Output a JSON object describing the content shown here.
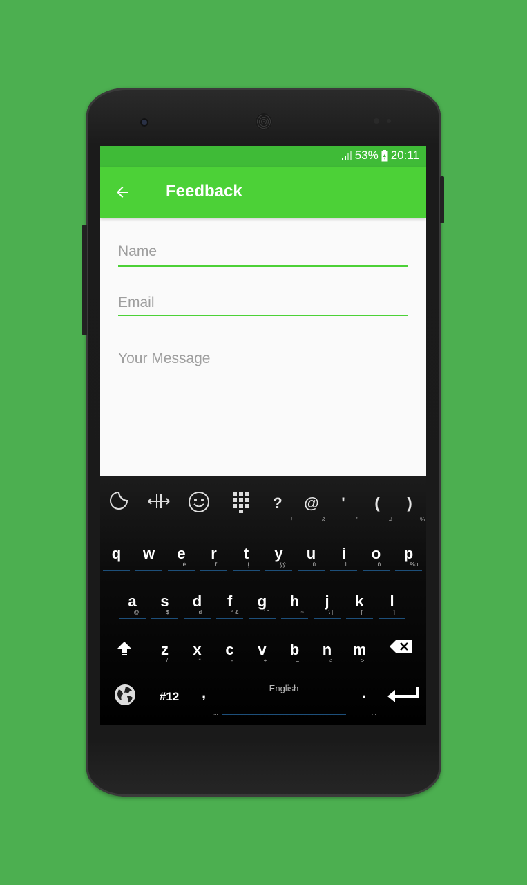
{
  "status_bar": {
    "battery": "53%",
    "time": "20:11"
  },
  "app_bar": {
    "title": "Feedback"
  },
  "form": {
    "name_placeholder": "Name",
    "email_placeholder": "Email",
    "message_placeholder": "Your Message"
  },
  "keyboard": {
    "symbols_row": [
      {
        "label": "?",
        "hint": "!"
      },
      {
        "label": "@",
        "hint": "&"
      },
      {
        "label": "'",
        "hint": "\""
      },
      {
        "label": "(",
        "hint": "#"
      },
      {
        "label": ")",
        "hint": "%"
      }
    ],
    "row1": [
      {
        "label": "q",
        "hint": ""
      },
      {
        "label": "w",
        "hint": ""
      },
      {
        "label": "e",
        "hint": "è"
      },
      {
        "label": "r",
        "hint": "ř"
      },
      {
        "label": "t",
        "hint": "ţ"
      },
      {
        "label": "y",
        "hint": "ÿý"
      },
      {
        "label": "u",
        "hint": "ü"
      },
      {
        "label": "i",
        "hint": "ì"
      },
      {
        "label": "o",
        "hint": "ö"
      },
      {
        "label": "p",
        "hint": "%π"
      }
    ],
    "row2": [
      {
        "label": "a",
        "hint": "@"
      },
      {
        "label": "s",
        "hint": "$"
      },
      {
        "label": "d",
        "hint": "d"
      },
      {
        "label": "f",
        "hint": "* &"
      },
      {
        "label": "g",
        "hint": "` \""
      },
      {
        "label": "h",
        "hint": "_ ~"
      },
      {
        "label": "j",
        "hint": "\\ |"
      },
      {
        "label": "k",
        "hint": "["
      },
      {
        "label": "l",
        "hint": "]"
      }
    ],
    "row3": [
      {
        "label": "z",
        "hint": "/"
      },
      {
        "label": "x",
        "hint": "*"
      },
      {
        "label": "c",
        "hint": "-"
      },
      {
        "label": "v",
        "hint": "+"
      },
      {
        "label": "b",
        "hint": "="
      },
      {
        "label": "n",
        "hint": "<"
      },
      {
        "label": "m",
        "hint": ">"
      }
    ],
    "numbers_key": "#12",
    "comma_key": ",",
    "space_label": "English",
    "period_key": ".",
    "ellipsis_hint": "..."
  },
  "colors": {
    "background": "#4caf50",
    "status_bar": "#3fbb37",
    "app_bar": "#4cd137",
    "accent": "#4cd137"
  }
}
